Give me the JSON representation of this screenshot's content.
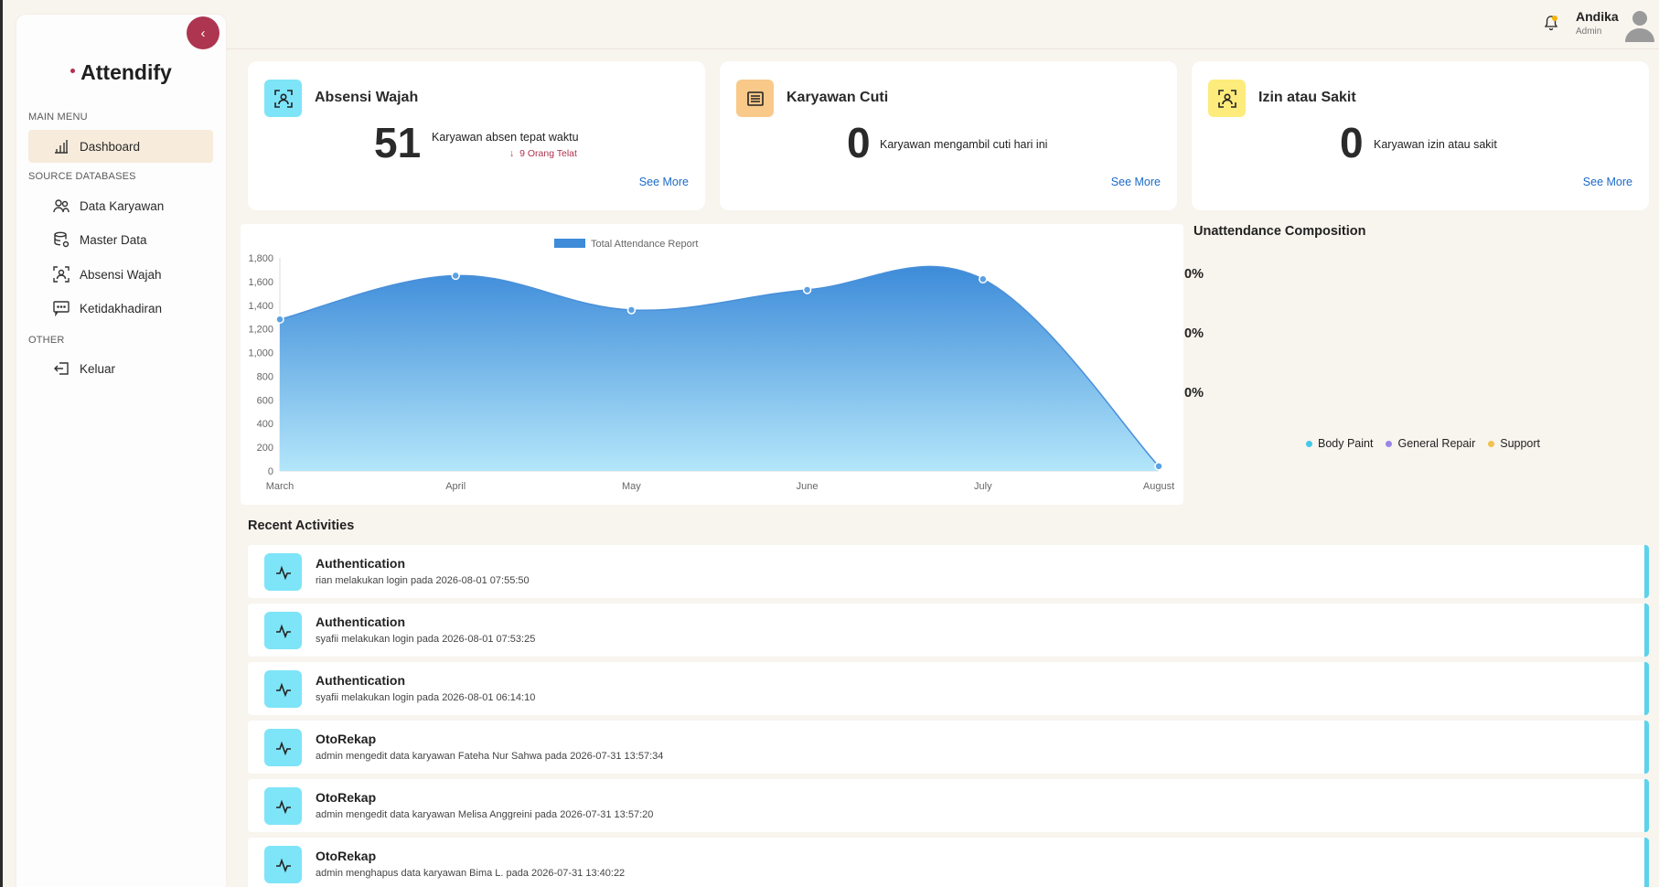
{
  "app": {
    "brand": "Attendify"
  },
  "header": {
    "user_name": "Andika",
    "user_role": "Admin"
  },
  "sidebar": {
    "sections": {
      "main": "MAIN MENU",
      "source": "SOURCE DATABASES",
      "other": "OTHER"
    },
    "items": [
      {
        "label": "Dashboard",
        "icon": "bar-chart-icon",
        "active": true
      },
      {
        "label": "Data Karyawan",
        "icon": "users-icon"
      },
      {
        "label": "Master Data",
        "icon": "database-icon"
      },
      {
        "label": "Absensi Wajah",
        "icon": "face-scan-icon"
      },
      {
        "label": "Ketidakhadiran",
        "icon": "message-dots-icon"
      },
      {
        "label": "Keluar",
        "icon": "logout-icon"
      }
    ]
  },
  "cards": [
    {
      "title": "Absensi Wajah",
      "value": "51",
      "desc": "Karyawan absen tepat waktu",
      "late": "9 Orang Telat",
      "late_arrow": "↓",
      "see_more": "See More",
      "icon_color": "#7ee4f8"
    },
    {
      "title": "Karyawan Cuti",
      "value": "0",
      "desc": "Karyawan mengambil cuti hari ini",
      "see_more": "See More",
      "icon_color": "#f9c98a"
    },
    {
      "title": "Izin atau Sakit",
      "value": "0",
      "desc": "Karyawan izin atau sakit",
      "see_more": "See More",
      "icon_color": "#fdeb7c"
    }
  ],
  "chart_data": {
    "type": "area",
    "title": "",
    "categories": [
      "March",
      "April",
      "May",
      "June",
      "July",
      "August"
    ],
    "series": [
      {
        "name": "Total Attendance Report",
        "values": [
          1280,
          1650,
          1360,
          1530,
          1620,
          40
        ]
      }
    ],
    "ylim": [
      0,
      1800
    ],
    "yticks": [
      "0",
      "200",
      "400",
      "600",
      "800",
      "1,000",
      "1,200",
      "1,400",
      "1,600",
      "1,800"
    ],
    "legend": "top",
    "grid": false,
    "color": "#3d8bd9"
  },
  "composition": {
    "title": "Unattendance Composition",
    "percents": [
      "0%",
      "0%",
      "0%"
    ],
    "legend": [
      {
        "name": "Body Paint",
        "color": "#45c8ea"
      },
      {
        "name": "General Repair",
        "color": "#9a86e8"
      },
      {
        "name": "Support",
        "color": "#f2c14e"
      }
    ]
  },
  "recent": {
    "title": "Recent Activities",
    "items": [
      {
        "title": "Authentication",
        "desc": "rian melakukan login pada 2026-08-01 07:55:50"
      },
      {
        "title": "Authentication",
        "desc": "syafii melakukan login pada 2026-08-01 07:53:25"
      },
      {
        "title": "Authentication",
        "desc": "syafii melakukan login pada 2026-08-01 06:14:10"
      },
      {
        "title": "OtoRekap",
        "desc": "admin mengedit data karyawan Fateha Nur Sahwa pada 2026-07-31 13:57:34"
      },
      {
        "title": "OtoRekap",
        "desc": "admin mengedit data karyawan Melisa Anggreini pada 2026-07-31 13:57:20"
      },
      {
        "title": "OtoRekap",
        "desc": "admin menghapus data karyawan Bima L. pada 2026-07-31 13:40:22"
      }
    ]
  }
}
